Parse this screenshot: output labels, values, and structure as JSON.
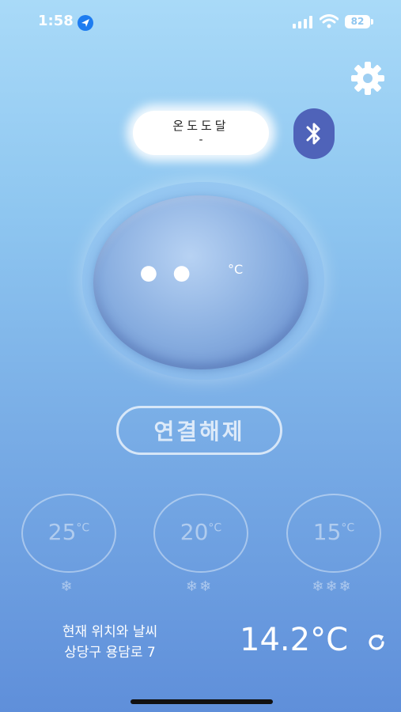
{
  "status_bar": {
    "time": "1:58",
    "battery": "82"
  },
  "device": {
    "name": "온도도달",
    "status": "-"
  },
  "dial": {
    "temperature": "••",
    "unit": "°C"
  },
  "disconnect_button": {
    "label": "연결해제"
  },
  "presets": [
    {
      "temp": "25",
      "unit": "°C",
      "snow": "❄"
    },
    {
      "temp": "20",
      "unit": "°C",
      "snow": "❄❄"
    },
    {
      "temp": "15",
      "unit": "°C",
      "snow": "❄❄❄"
    }
  ],
  "location": {
    "line1": "현재 위치와 날씨",
    "line2": "상당구 용담로 7"
  },
  "weather": {
    "temperature": "14.2°C"
  },
  "colors": {
    "bluetooth_button": "#4f63b9",
    "background_top": "#a9daf8",
    "background_bottom": "#5f8fda"
  },
  "icons": [
    "location-arrow-icon",
    "signal-icon",
    "wifi-icon",
    "gear-icon",
    "bluetooth-icon",
    "snowflake-icon",
    "refresh-icon"
  ]
}
